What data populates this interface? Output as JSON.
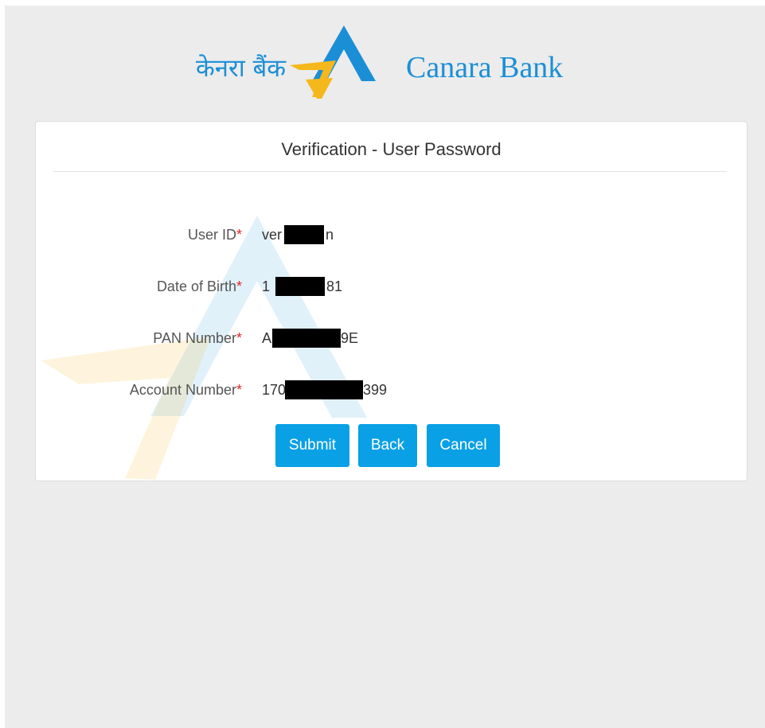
{
  "header": {
    "logo_hindi": "केनरा बैंक",
    "logo_english": "Canara Bank",
    "logo_icon": "canara-triangle-logo"
  },
  "card": {
    "title": "Verification - User Password"
  },
  "fields": [
    {
      "label": "User ID",
      "required_mark": "*",
      "value_prefix": "ver",
      "value_suffix": "n"
    },
    {
      "label": "Date of Birth",
      "required_mark": "*",
      "value_prefix": "1",
      "value_suffix": "81"
    },
    {
      "label": "PAN Number",
      "required_mark": "*",
      "value_prefix": "A",
      "value_suffix": "9E"
    },
    {
      "label": "Account Number",
      "required_mark": "*",
      "value_prefix": "170",
      "value_suffix": "399"
    }
  ],
  "buttons": {
    "submit": "Submit",
    "back": "Back",
    "cancel": "Cancel"
  },
  "colors": {
    "brand_blue": "#1b8fd6",
    "brand_yellow": "#f5b81c",
    "button": "#0aa0e6",
    "required": "#e0262b"
  }
}
